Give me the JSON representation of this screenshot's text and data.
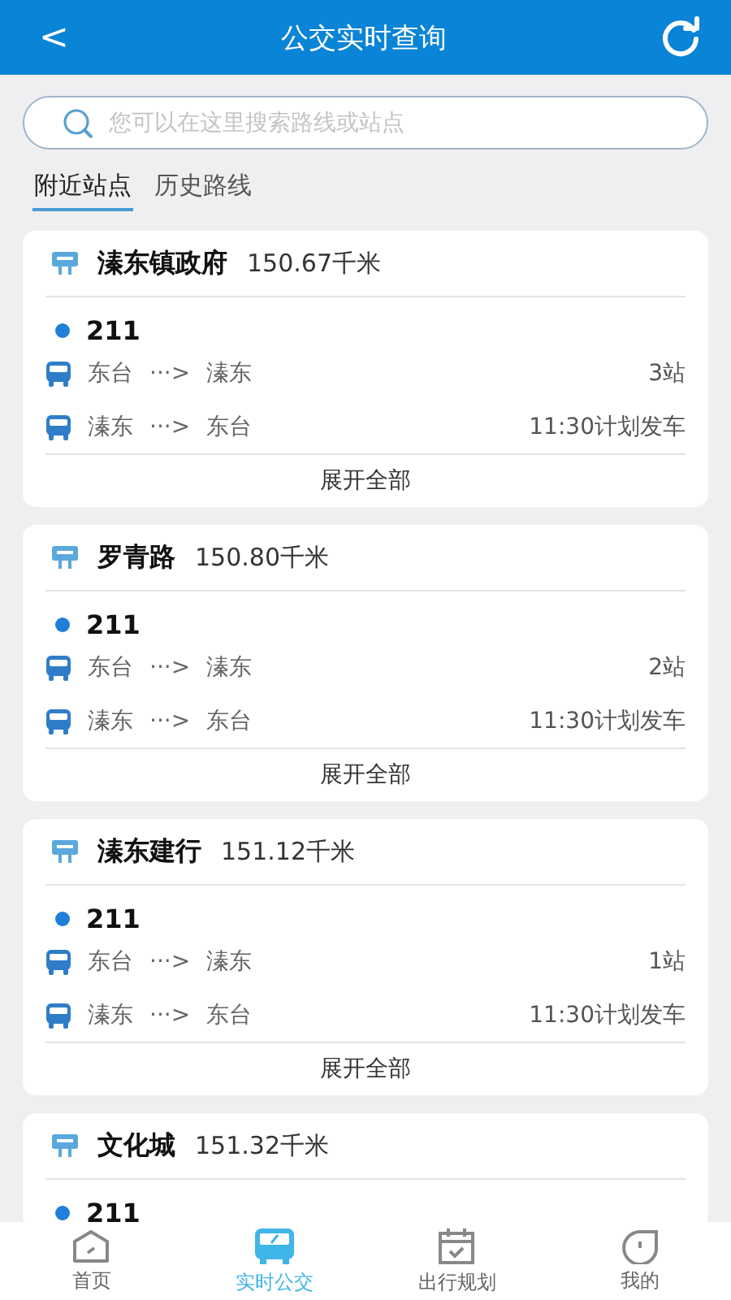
{
  "header": {
    "back": "<",
    "title": "公交实时查询"
  },
  "search": {
    "placeholder": "您可以在这里搜索路线或站点"
  },
  "tabs": [
    {
      "label": "附近站点",
      "selected": true
    },
    {
      "label": "历史路线",
      "selected": false
    }
  ],
  "stations": [
    {
      "name": "溱东镇政府",
      "distance": "150.67千米",
      "line": "211",
      "routes": [
        {
          "from": "东台",
          "arrow": "···>",
          "to": "溱东",
          "info": "3站"
        },
        {
          "from": "溱东",
          "arrow": "···>",
          "to": "东台",
          "info": "11:30计划发车"
        }
      ],
      "expand": "展开全部"
    },
    {
      "name": "罗青路",
      "distance": "150.80千米",
      "line": "211",
      "routes": [
        {
          "from": "东台",
          "arrow": "···>",
          "to": "溱东",
          "info": "2站"
        },
        {
          "from": "溱东",
          "arrow": "···>",
          "to": "东台",
          "info": "11:30计划发车"
        }
      ],
      "expand": "展开全部"
    },
    {
      "name": "溱东建行",
      "distance": "151.12千米",
      "line": "211",
      "routes": [
        {
          "from": "东台",
          "arrow": "···>",
          "to": "溱东",
          "info": "1站"
        },
        {
          "from": "溱东",
          "arrow": "···>",
          "to": "东台",
          "info": "11:30计划发车"
        }
      ],
      "expand": "展开全部"
    },
    {
      "name": "文化城",
      "distance": "151.32千米",
      "line": "211"
    }
  ],
  "nav": [
    {
      "kind": "home",
      "label": "首页",
      "selected": false
    },
    {
      "kind": "bus",
      "label": "实时公交",
      "selected": true
    },
    {
      "kind": "calendar",
      "label": "出行规划",
      "selected": false
    },
    {
      "kind": "me",
      "label": "我的",
      "selected": false
    }
  ]
}
